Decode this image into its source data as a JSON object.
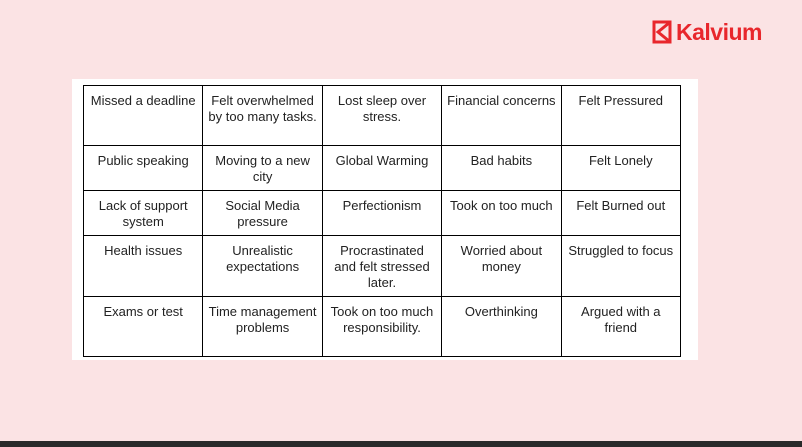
{
  "brand": {
    "name": "Kalvium",
    "color": "#e8272c"
  },
  "grid": {
    "rows": [
      [
        "Missed a deadline",
        "Felt overwhelmed by too many tasks.",
        "Lost sleep over stress.",
        "Financial concerns",
        "Felt Pressured"
      ],
      [
        "Public speaking",
        "Moving to a new city",
        "Global Warming",
        "Bad habits",
        "Felt Lonely"
      ],
      [
        "Lack of support system",
        "Social Media pressure",
        "Perfectionism",
        "Took on too much",
        "Felt Burned out"
      ],
      [
        "Health issues",
        "Unrealistic expectations",
        "Procrastinated and felt stressed later.",
        "Worried about money",
        "Struggled to focus"
      ],
      [
        "Exams or test",
        "Time management problems",
        "Took on too much responsibility.",
        "Overthinking",
        "Argued with a friend"
      ]
    ]
  },
  "colors": {
    "background": "#fbe3e4",
    "border": "#000000"
  }
}
